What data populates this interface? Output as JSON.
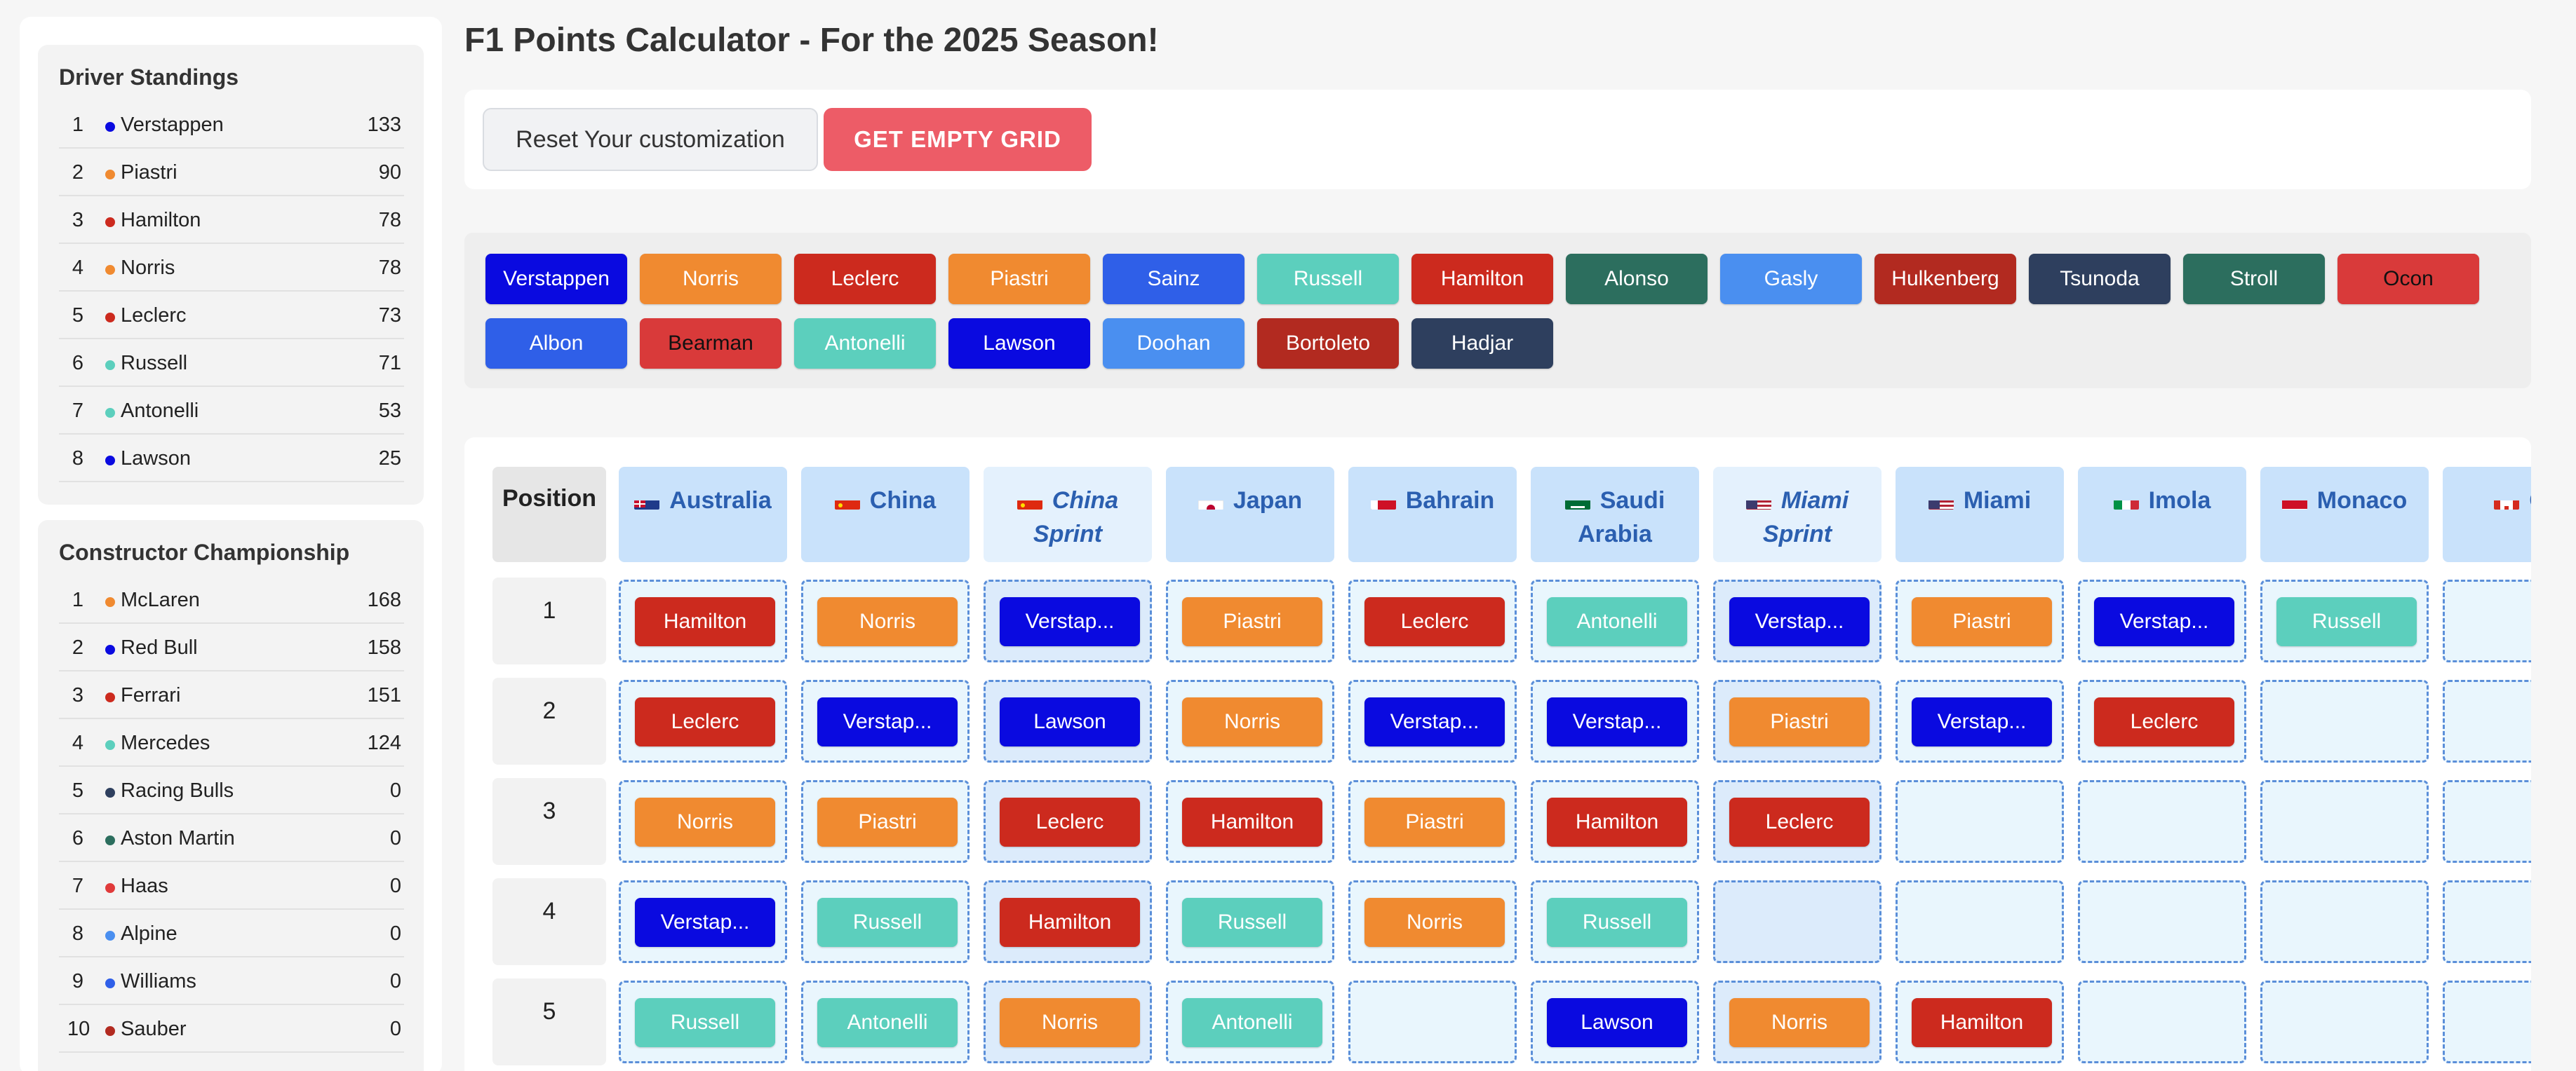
{
  "sidebar": {
    "drivers_title": "Driver Standings",
    "drivers": [
      {
        "pos": "1",
        "name": "Verstappen",
        "points": "133",
        "color": "#0a0ae0"
      },
      {
        "pos": "2",
        "name": "Piastri",
        "points": "90",
        "color": "#f08a30"
      },
      {
        "pos": "3",
        "name": "Hamilton",
        "points": "78",
        "color": "#cc2a1e"
      },
      {
        "pos": "4",
        "name": "Norris",
        "points": "78",
        "color": "#f08a30"
      },
      {
        "pos": "5",
        "name": "Leclerc",
        "points": "73",
        "color": "#cc2a1e"
      },
      {
        "pos": "6",
        "name": "Russell",
        "points": "71",
        "color": "#5ccfbd"
      },
      {
        "pos": "7",
        "name": "Antonelli",
        "points": "53",
        "color": "#5ccfbd"
      },
      {
        "pos": "8",
        "name": "Lawson",
        "points": "25",
        "color": "#0a0ae0"
      }
    ],
    "constructors_title": "Constructor Championship",
    "constructors": [
      {
        "pos": "1",
        "name": "McLaren",
        "points": "168",
        "color": "#f08a30"
      },
      {
        "pos": "2",
        "name": "Red Bull",
        "points": "158",
        "color": "#0a0ae0"
      },
      {
        "pos": "3",
        "name": "Ferrari",
        "points": "151",
        "color": "#cc2a1e"
      },
      {
        "pos": "4",
        "name": "Mercedes",
        "points": "124",
        "color": "#5ccfbd"
      },
      {
        "pos": "5",
        "name": "Racing Bulls",
        "points": "0",
        "color": "#2e3f5e"
      },
      {
        "pos": "6",
        "name": "Aston Martin",
        "points": "0",
        "color": "#2c6e5e"
      },
      {
        "pos": "7",
        "name": "Haas",
        "points": "0",
        "color": "#e03a3a"
      },
      {
        "pos": "8",
        "name": "Alpine",
        "points": "0",
        "color": "#4a8ff0"
      },
      {
        "pos": "9",
        "name": "Williams",
        "points": "0",
        "color": "#2f5fe8"
      },
      {
        "pos": "10",
        "name": "Sauber",
        "points": "0",
        "color": "#b22a20"
      }
    ]
  },
  "main": {
    "title": "F1 Points Calculator - For the 2025 Season!",
    "reset_label": "Reset Your customization",
    "empty_grid_label": "GET EMPTY GRID"
  },
  "palette": [
    {
      "name": "Verstappen",
      "color": "#0a0ae0",
      "dark": false
    },
    {
      "name": "Norris",
      "color": "#f08a30",
      "dark": false
    },
    {
      "name": "Leclerc",
      "color": "#cc2a1e",
      "dark": false
    },
    {
      "name": "Piastri",
      "color": "#f08a30",
      "dark": false
    },
    {
      "name": "Sainz",
      "color": "#2f5fe8",
      "dark": false
    },
    {
      "name": "Russell",
      "color": "#5ccfbd",
      "dark": false
    },
    {
      "name": "Hamilton",
      "color": "#cc2a1e",
      "dark": false
    },
    {
      "name": "Alonso",
      "color": "#2c6e5e",
      "dark": false
    },
    {
      "name": "Gasly",
      "color": "#4a8ff0",
      "dark": false
    },
    {
      "name": "Hulkenberg",
      "color": "#b22a20",
      "dark": false
    },
    {
      "name": "Tsunoda",
      "color": "#2e3f5e",
      "dark": false
    },
    {
      "name": "Stroll",
      "color": "#2c6e5e",
      "dark": false
    },
    {
      "name": "Ocon",
      "color": "#d93a3a",
      "dark": true
    },
    {
      "name": "Albon",
      "color": "#2f5fe8",
      "dark": false
    },
    {
      "name": "Bearman",
      "color": "#d93a3a",
      "dark": true
    },
    {
      "name": "Antonelli",
      "color": "#5ccfbd",
      "dark": false
    },
    {
      "name": "Lawson",
      "color": "#0a0ae0",
      "dark": false
    },
    {
      "name": "Doohan",
      "color": "#4a8ff0",
      "dark": false
    },
    {
      "name": "Bortoleto",
      "color": "#b22a20",
      "dark": false
    },
    {
      "name": "Hadjar",
      "color": "#2e3f5e",
      "dark": false
    }
  ],
  "grid": {
    "position_header": "Position",
    "races": [
      {
        "name": "Australia",
        "flag": "au",
        "sprint": false
      },
      {
        "name": "China",
        "flag": "cn",
        "sprint": false
      },
      {
        "name": "China Sprint",
        "flag": "cn",
        "sprint": true
      },
      {
        "name": "Japan",
        "flag": "jp",
        "sprint": false
      },
      {
        "name": "Bahrain",
        "flag": "bh",
        "sprint": false
      },
      {
        "name": "Saudi Arabia",
        "flag": "sa",
        "sprint": false
      },
      {
        "name": "Miami Sprint",
        "flag": "us",
        "sprint": true
      },
      {
        "name": "Miami",
        "flag": "us",
        "sprint": false
      },
      {
        "name": "Imola",
        "flag": "it",
        "sprint": false
      },
      {
        "name": "Monaco",
        "flag": "mc",
        "sprint": false
      },
      {
        "name": "Ca",
        "flag": "ca",
        "sprint": false
      }
    ],
    "positions": [
      "1",
      "2",
      "3",
      "4",
      "5"
    ],
    "results": [
      [
        "Hamilton",
        "Norris",
        "Verstap...",
        "Piastri",
        "Leclerc",
        "Antonelli",
        "Verstap...",
        "Piastri",
        "Verstap...",
        "Russell",
        ""
      ],
      [
        "Leclerc",
        "Verstap...",
        "Lawson",
        "Norris",
        "Verstap...",
        "Verstap...",
        "Piastri",
        "Verstap...",
        "Leclerc",
        "",
        ""
      ],
      [
        "Norris",
        "Piastri",
        "Leclerc",
        "Hamilton",
        "Piastri",
        "Hamilton",
        "Leclerc",
        "",
        "",
        "",
        ""
      ],
      [
        "Verstap...",
        "Russell",
        "Hamilton",
        "Russell",
        "Norris",
        "Russell",
        "",
        "",
        "",
        "",
        ""
      ],
      [
        "Russell",
        "Antonelli",
        "Norris",
        "Antonelli",
        "",
        "Lawson",
        "Norris",
        "Hamilton",
        "",
        "",
        ""
      ]
    ]
  },
  "driver_colors": {
    "Hamilton": "#cc2a1e",
    "Leclerc": "#cc2a1e",
    "Norris": "#f08a30",
    "Piastri": "#f08a30",
    "Verstap...": "#0a0ae0",
    "Lawson": "#0a0ae0",
    "Russell": "#5ccfbd",
    "Antonelli": "#5ccfbd"
  }
}
